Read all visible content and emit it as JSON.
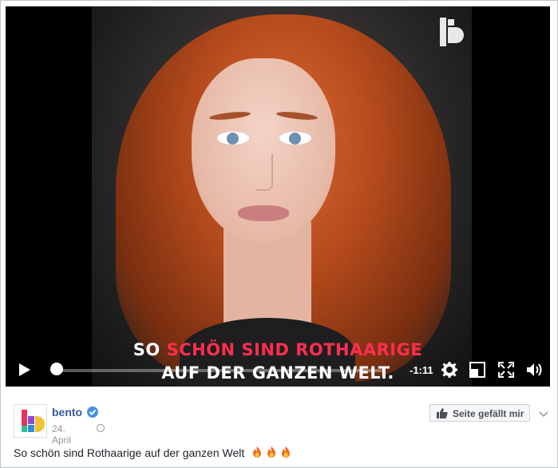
{
  "video": {
    "caption_line1_part1": "SO ",
    "caption_line1_part2": "SCHÖN SIND ROTHAARIGE",
    "caption_line2": "AUF DER GANZEN WELT.",
    "time_remaining": "-1:11",
    "progress_fraction": 0.02,
    "caption_accent_color": "#ff2e4f"
  },
  "post": {
    "page_name": "bento",
    "date": "24. April",
    "like_page_label": "Seite gefällt mir",
    "text": "So schön sind Rothaarige auf der ganzen Welt",
    "verified_color": "#4a90e2",
    "link_color": "#365899"
  }
}
